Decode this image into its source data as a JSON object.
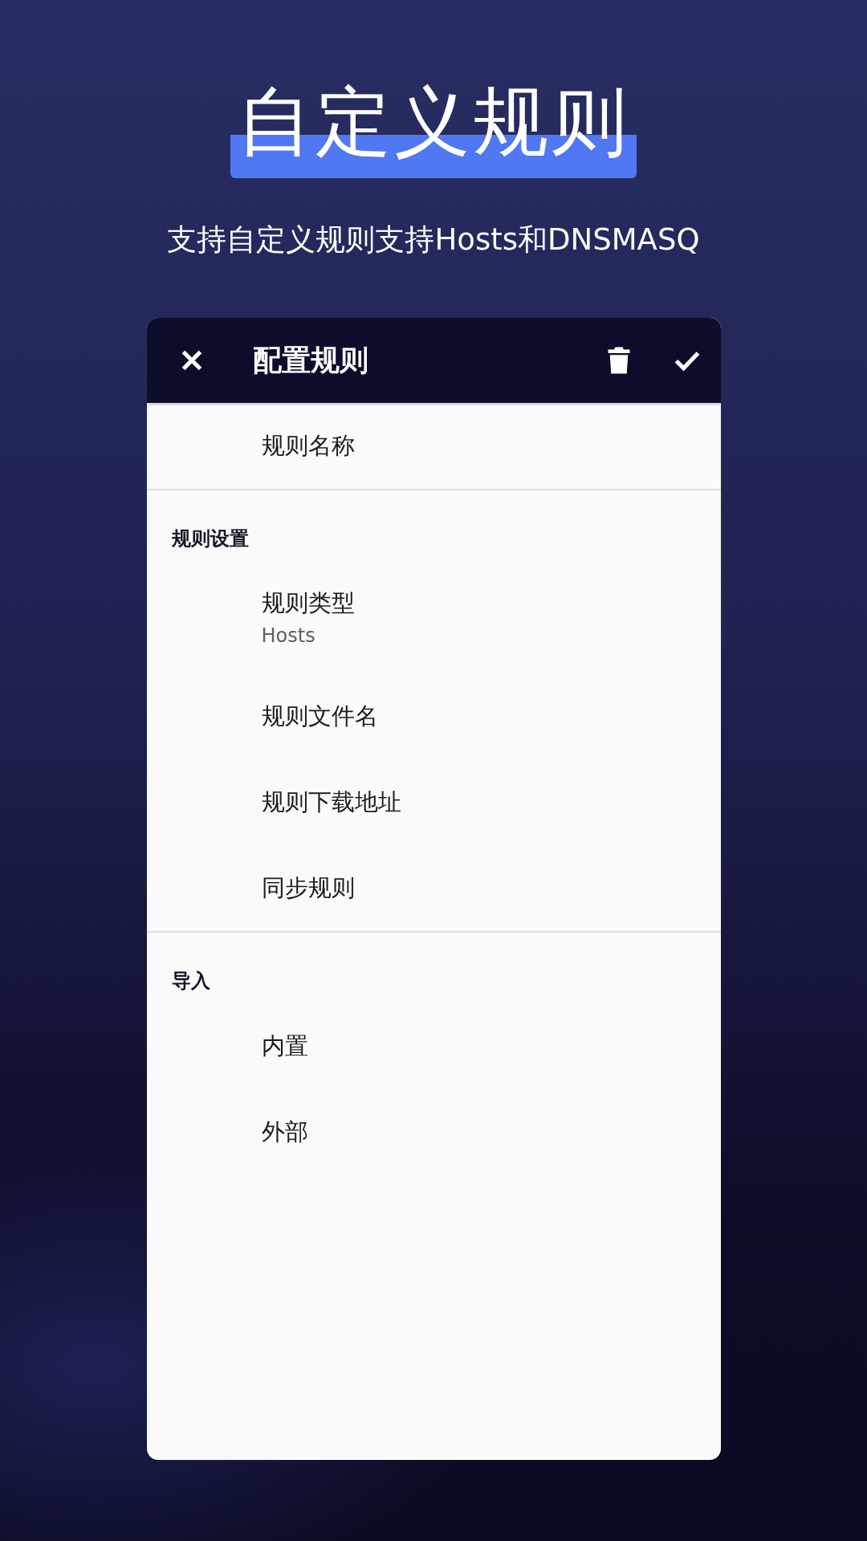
{
  "headline": {
    "title": "自定义规则",
    "subtitle": "支持自定义规则支持Hosts和DNSMASQ"
  },
  "toolbar": {
    "title": "配置规则"
  },
  "sections": [
    {
      "items": [
        {
          "title": "规则名称"
        }
      ]
    },
    {
      "header": "规则设置",
      "items": [
        {
          "title": "规则类型",
          "summary": "Hosts"
        },
        {
          "title": "规则文件名"
        },
        {
          "title": "规则下载地址"
        },
        {
          "title": "同步规则"
        }
      ]
    },
    {
      "header": "导入",
      "items": [
        {
          "title": "内置"
        },
        {
          "title": "外部"
        }
      ]
    }
  ]
}
